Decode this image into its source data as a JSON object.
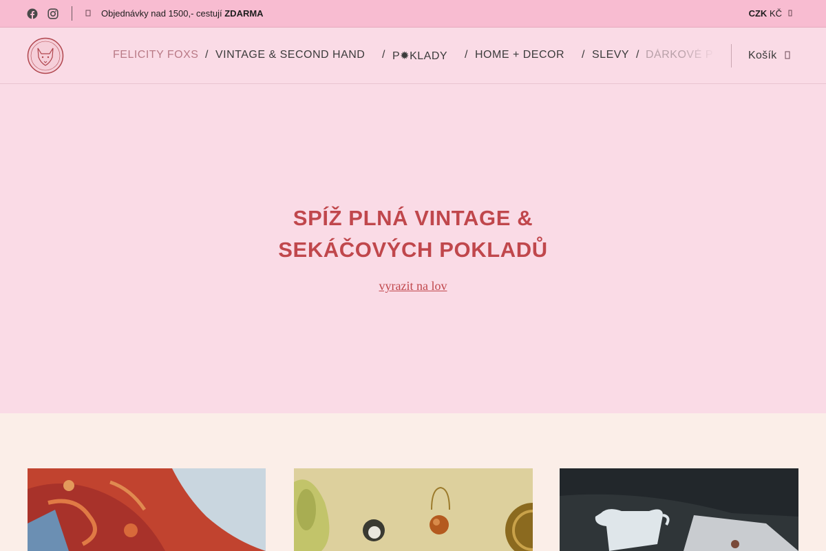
{
  "topbar": {
    "social": [
      "facebook-icon",
      "instagram-icon"
    ],
    "notice_text": "Objednávky nad 1500,- cestují ",
    "notice_bold": "ZDARMA",
    "currency_code": "CZK",
    "currency_symbol": "KČ"
  },
  "header": {
    "nav": [
      {
        "label": "FELICITY FOXS",
        "active": true
      },
      {
        "label": "VINTAGE & SECOND HAND"
      },
      {
        "label": "P✹KLADY"
      },
      {
        "label": "HOME + DECOR"
      },
      {
        "label": "SLEVY"
      },
      {
        "label": "DÁRKOVÉ P"
      }
    ],
    "separator": "/",
    "cart_label": "Košík"
  },
  "hero": {
    "title_line1": "SPÍŽ PLNÁ VINTAGE &",
    "title_line2": "SEKÁČOVÝCH POKLADŮ",
    "cta_label": "vyrazit na lov"
  },
  "colors": {
    "topbar_bg": "#f8bcd1",
    "header_bg": "#fadbe6",
    "section_bg": "#fbeee8",
    "accent": "#c0474c",
    "nav_active": "#b97a86"
  }
}
